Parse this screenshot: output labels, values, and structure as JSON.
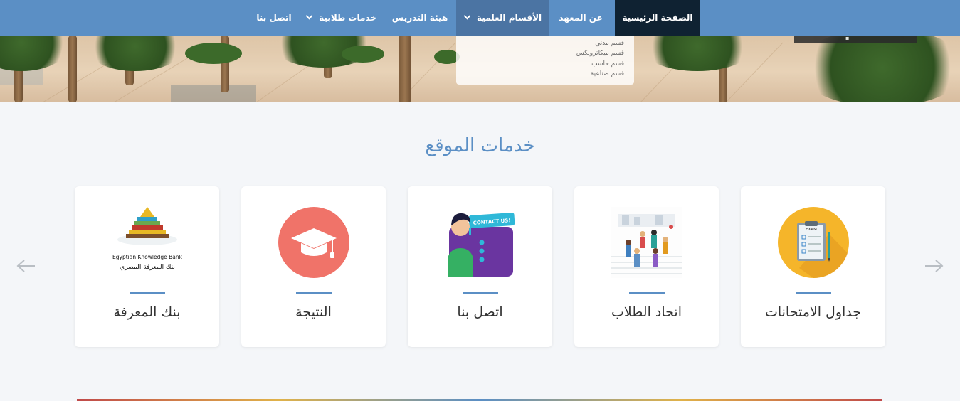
{
  "nav": {
    "items": [
      {
        "label": "الصفحة الرئيسية",
        "dropdown": false
      },
      {
        "label": "عن المعهد",
        "dropdown": false
      },
      {
        "label": "الأقسام العلمية",
        "dropdown": true
      },
      {
        "label": "هيئة التدريس",
        "dropdown": false
      },
      {
        "label": "خدمات طلابية",
        "dropdown": true
      },
      {
        "label": "اتصل بنا",
        "dropdown": false
      }
    ]
  },
  "dropdown": {
    "items": [
      "قسم مدني",
      "قسم ميكاترونكس",
      "قسم حاسب",
      "قسم صناعية"
    ]
  },
  "services": {
    "title": "خدمات الموقع",
    "cards": [
      {
        "label": "جداول الامتحانات",
        "icon": "exam-clipboard-icon"
      },
      {
        "label": "اتحاد الطلاب",
        "icon": "students-group-icon"
      },
      {
        "label": "اتصل بنا",
        "icon": "contact-us-icon"
      },
      {
        "label": "النتيجة",
        "icon": "graduation-cap-icon"
      },
      {
        "label": "بنك المعرفة",
        "icon": "knowledge-bank-logo"
      }
    ],
    "ekb_logo_text_en": "Egyptian Knowledge Bank",
    "ekb_logo_text_ar": "بنك المعرفة المصري",
    "contact_badge_text": "CONTACT US!",
    "exam_badge_text": "EXAM"
  },
  "colors": {
    "nav_bg": "#5b8fc5",
    "home_bg": "#0f2232",
    "accent": "#5b8fc5",
    "grad_circle": "#f07369",
    "exam_circle": "#f5b52a"
  }
}
